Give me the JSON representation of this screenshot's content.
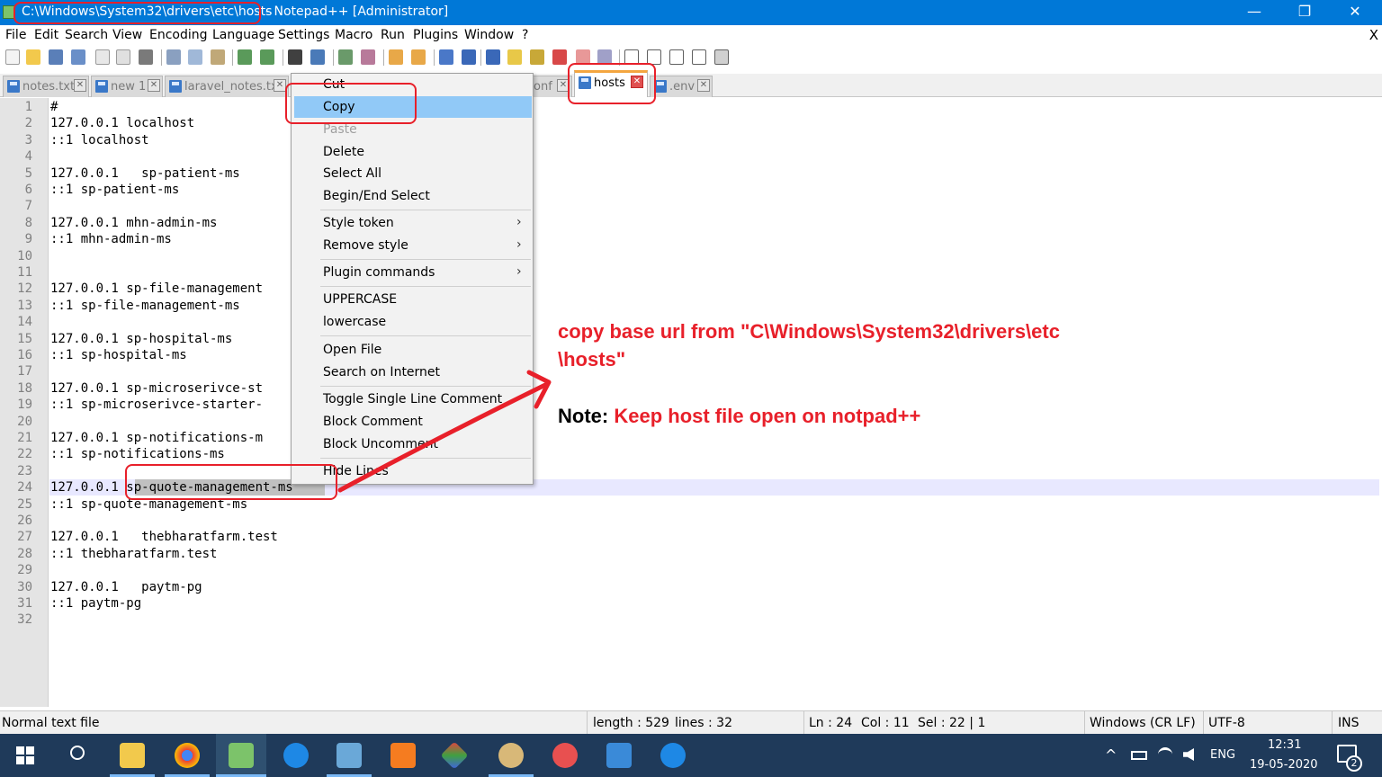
{
  "window": {
    "title_path": "C:\\Windows\\System32\\drivers\\etc\\hosts",
    "title_rest": "- Notepad++ [Administrator]",
    "minimize": "—",
    "maximize": "❐",
    "close": "✕"
  },
  "menu": {
    "items": [
      "File",
      "Edit",
      "Search",
      "View",
      "Encoding",
      "Language",
      "Settings",
      "Macro",
      "Run",
      "Plugins",
      "Window",
      "?"
    ],
    "close": "X"
  },
  "tabs": [
    {
      "label": "notes.txt",
      "active": false
    },
    {
      "label": "new 1",
      "active": false
    },
    {
      "label": "laravel_notes.txt",
      "active": false
    },
    {
      "label": "onf",
      "active": false
    },
    {
      "label": "hosts",
      "active": true
    },
    {
      "label": ".env",
      "active": false
    }
  ],
  "tab_close": "✕",
  "editor": {
    "lines": [
      "#",
      "127.0.0.1 localhost",
      "::1 localhost",
      "",
      "127.0.0.1   sp-patient-ms",
      "::1 sp-patient-ms",
      "",
      "127.0.0.1 mhn-admin-ms",
      "::1 mhn-admin-ms",
      "",
      "",
      "127.0.0.1 sp-file-management",
      "::1 sp-file-management-ms",
      "",
      "127.0.0.1 sp-hospital-ms",
      "::1 sp-hospital-ms",
      "",
      "127.0.0.1 sp-microserivce-st",
      "::1 sp-microserivce-starter-",
      "",
      "127.0.0.1 sp-notifications-m",
      "::1 sp-notifications-ms",
      "",
      "127.0.0.1 sp-quote-management-ms",
      "::1 sp-quote-management-ms",
      "",
      "127.0.0.1   thebharatfarm.test",
      "::1 thebharatfarm.test",
      "",
      "127.0.0.1   paytm-pg",
      "::1 paytm-pg",
      ""
    ]
  },
  "context_menu": {
    "items": [
      {
        "label": "Cut",
        "disabled": false
      },
      {
        "label": "Copy",
        "disabled": false
      },
      {
        "label": "Paste",
        "disabled": true
      },
      {
        "label": "Delete",
        "disabled": false
      },
      {
        "label": "Select All",
        "disabled": false
      },
      {
        "label": "Begin/End Select",
        "disabled": false
      },
      {
        "label": "Style token",
        "submenu": true
      },
      {
        "label": "Remove style",
        "submenu": true
      },
      {
        "label": "Plugin commands",
        "submenu": true
      },
      {
        "label": "UPPERCASE",
        "disabled": false
      },
      {
        "label": "lowercase",
        "disabled": false
      },
      {
        "label": "Open File",
        "disabled": false
      },
      {
        "label": "Search on Internet",
        "disabled": false
      },
      {
        "label": "Toggle Single Line Comment",
        "disabled": false
      },
      {
        "label": "Block Comment",
        "disabled": false
      },
      {
        "label": "Block Uncomment",
        "disabled": false
      },
      {
        "label": "Hide Lines",
        "disabled": false
      }
    ],
    "submenu_arrow": "›"
  },
  "annotation": {
    "line1": "copy base url from \"C\\Windows\\System32\\drivers\\etc",
    "line2": "\\hosts\"",
    "note_label": "Note:",
    "note_text": "Keep host file open on notpad++",
    "accent": "#e8202a"
  },
  "status": {
    "file_type": "Normal text file",
    "length": "length : 529",
    "lines": "lines : 32",
    "ln": "Ln : 24",
    "col": "Col : 11",
    "sel": "Sel : 22 | 1",
    "eol": "Windows (CR LF)",
    "encoding": "UTF-8",
    "mode": "INS"
  },
  "taskbar": {
    "lang": "ENG",
    "time": "12:31",
    "date": "19-05-2020",
    "notifications": "2",
    "tray_chevron": "^"
  }
}
